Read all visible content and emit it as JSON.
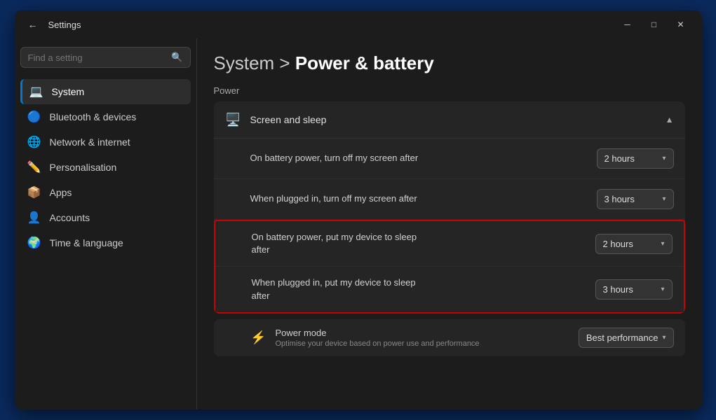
{
  "window": {
    "title": "Settings",
    "back_icon": "←",
    "minimize_icon": "─",
    "maximize_icon": "□",
    "close_icon": "✕"
  },
  "sidebar": {
    "search_placeholder": "Find a setting",
    "search_icon": "🔍",
    "items": [
      {
        "id": "system",
        "label": "System",
        "icon": "💻",
        "active": true
      },
      {
        "id": "bluetooth",
        "label": "Bluetooth & devices",
        "icon": "🔵"
      },
      {
        "id": "network",
        "label": "Network & internet",
        "icon": "🌐"
      },
      {
        "id": "personalisation",
        "label": "Personalisation",
        "icon": "✏️"
      },
      {
        "id": "apps",
        "label": "Apps",
        "icon": "📦"
      },
      {
        "id": "accounts",
        "label": "Accounts",
        "icon": "👤"
      },
      {
        "id": "time",
        "label": "Time & language",
        "icon": "🌍"
      }
    ]
  },
  "main": {
    "breadcrumb_system": "System",
    "breadcrumb_separator": ">",
    "page_title": "Power & battery",
    "section_label": "Power",
    "cards": [
      {
        "id": "screen-sleep",
        "icon": "🖥️",
        "title": "Screen and sleep",
        "expanded": true,
        "settings": [
          {
            "label": "On battery power, turn off my screen after",
            "value": "2 hours",
            "highlighted": false
          },
          {
            "label": "When plugged in, turn off my screen after",
            "value": "3 hours",
            "highlighted": false
          },
          {
            "label": "On battery power, put my device to sleep after",
            "value": "2 hours",
            "highlighted": true
          },
          {
            "label": "When plugged in, put my device to sleep after",
            "value": "3 hours",
            "highlighted": true
          }
        ]
      }
    ],
    "power_mode": {
      "icon": "⚡",
      "title": "Power mode",
      "subtitle": "Optimise your device based on power use and performance",
      "value": "Best performance"
    }
  }
}
